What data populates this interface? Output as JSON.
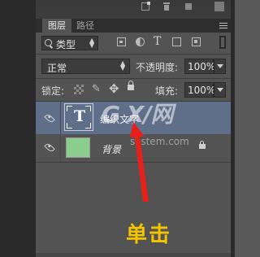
{
  "panel": {
    "tabs": [
      {
        "label": "图层"
      },
      {
        "label": "路径"
      }
    ]
  },
  "filter": {
    "kind_label": "类型",
    "icons": [
      "image-filter-icon",
      "adjustment-filter-icon",
      "text-filter-icon",
      "shape-filter-icon",
      "smart-object-filter-icon"
    ]
  },
  "blend": {
    "mode": "正常",
    "opacity_label": "不透明度:",
    "opacity_value": "100%"
  },
  "lock": {
    "label": "锁定:",
    "fill_label": "填充:",
    "fill_value": "100%"
  },
  "layers": [
    {
      "name": "编织文字",
      "thumb": "T",
      "selected": true
    },
    {
      "name": "背景",
      "thumb_color": "#8ccf8c",
      "locked": true
    }
  ],
  "watermark": {
    "main": "G X/网",
    "sub": "system.com"
  },
  "annotation": {
    "label": "单击",
    "color": "#f5c400",
    "arrow_color": "#e8201a"
  }
}
